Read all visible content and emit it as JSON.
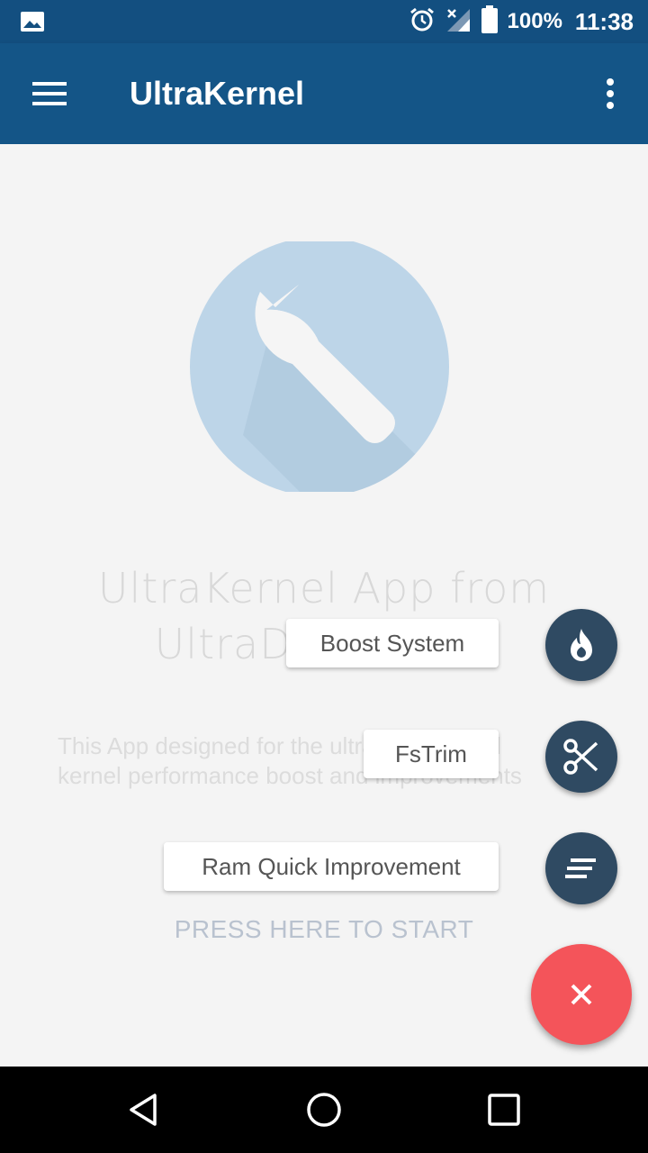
{
  "status_bar": {
    "battery_text": "100%",
    "time": "11:38",
    "icons": [
      "image-icon",
      "alarm-icon",
      "signal-off-icon",
      "battery-icon"
    ]
  },
  "app_bar": {
    "title": "UltraKernel",
    "icons": [
      "menu-icon",
      "more-vert-icon"
    ]
  },
  "hero": {
    "icon": "wrench-icon",
    "circle_color": "#bdd5e8"
  },
  "main": {
    "headline_line1": "UltraKernel App from",
    "headline_line2": "UltraDevs Team",
    "description_line1": "This App designed for the ultra system and",
    "description_line2": "kernel performance boost and improvements",
    "press_text": "PRESS HERE TO START"
  },
  "fab_menu": {
    "items": [
      {
        "label": "Boost System",
        "icon": "flame-icon"
      },
      {
        "label": "FsTrim",
        "icon": "scissors-icon"
      },
      {
        "label": "Ram Quick Improvement",
        "icon": "sort-icon"
      }
    ],
    "close_icon": "close-icon",
    "mini_color": "#2f4a62",
    "main_color": "#f4545a"
  },
  "nav_bar": {
    "icons": [
      "back-icon",
      "home-icon",
      "recents-icon"
    ]
  },
  "colors": {
    "primary": "#145587",
    "status_bar": "#134f80",
    "background": "#f4f4f4"
  }
}
